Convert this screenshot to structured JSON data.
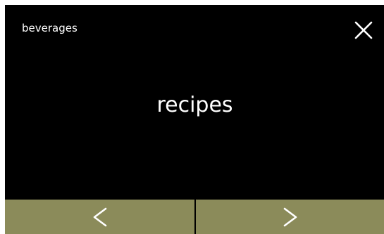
{
  "header": {
    "title": "beverages",
    "close_icon": "close-icon"
  },
  "main": {
    "label": "recipes"
  },
  "nav": {
    "prev_icon": "chevron-left-icon",
    "next_icon": "chevron-right-icon"
  },
  "colors": {
    "background": "#000000",
    "text": "#ffffff",
    "nav_button": "#8b8b5a"
  }
}
